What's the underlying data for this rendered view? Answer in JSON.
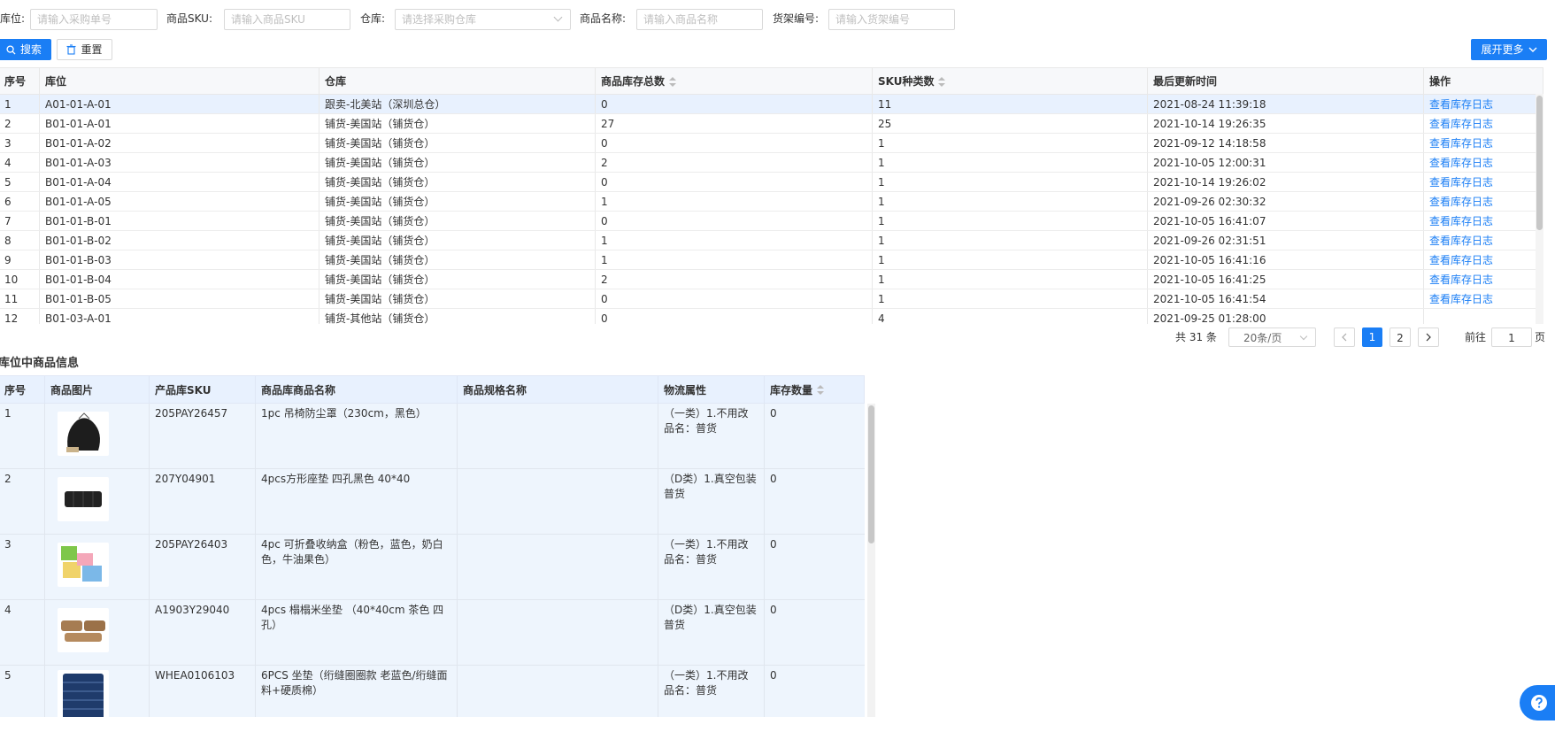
{
  "filters": {
    "location": {
      "label": "库位:",
      "placeholder": "请输入采购单号"
    },
    "sku": {
      "label": "商品SKU:",
      "placeholder": "请输入商品SKU"
    },
    "warehouse": {
      "label": "仓库:",
      "placeholder": "请选择采购仓库"
    },
    "name": {
      "label": "商品名称:",
      "placeholder": "请输入商品名称"
    },
    "shelf": {
      "label": "货架编号:",
      "placeholder": "请输入货架编号"
    }
  },
  "buttons": {
    "search": "搜索",
    "reset": "重置",
    "expand": "展开更多"
  },
  "colors": {
    "primary": "#1a7ef5",
    "selected_row": "#e8f1fe"
  },
  "main_table": {
    "columns": [
      "序号",
      "库位",
      "仓库",
      "商品库存总数",
      "SKU种类数",
      "最后更新时间",
      "操作"
    ],
    "rows": [
      {
        "no": "1",
        "loc": "A01-01-A-01",
        "wh": "跟卖-北美站（深圳总仓）",
        "total": "0",
        "kinds": "11",
        "time": "2021-08-24 11:39:18",
        "action": "查看库存日志"
      },
      {
        "no": "2",
        "loc": "B01-01-A-01",
        "wh": "铺货-美国站（铺货仓）",
        "total": "27",
        "kinds": "25",
        "time": "2021-10-14 19:26:35",
        "action": "查看库存日志"
      },
      {
        "no": "3",
        "loc": "B01-01-A-02",
        "wh": "铺货-美国站（铺货仓）",
        "total": "0",
        "kinds": "1",
        "time": "2021-09-12 14:18:58",
        "action": "查看库存日志"
      },
      {
        "no": "4",
        "loc": "B01-01-A-03",
        "wh": "铺货-美国站（铺货仓）",
        "total": "2",
        "kinds": "1",
        "time": "2021-10-05 12:00:31",
        "action": "查看库存日志"
      },
      {
        "no": "5",
        "loc": "B01-01-A-04",
        "wh": "铺货-美国站（铺货仓）",
        "total": "0",
        "kinds": "1",
        "time": "2021-10-14 19:26:02",
        "action": "查看库存日志"
      },
      {
        "no": "6",
        "loc": "B01-01-A-05",
        "wh": "铺货-美国站（铺货仓）",
        "total": "1",
        "kinds": "1",
        "time": "2021-09-26 02:30:32",
        "action": "查看库存日志"
      },
      {
        "no": "7",
        "loc": "B01-01-B-01",
        "wh": "铺货-美国站（铺货仓）",
        "total": "0",
        "kinds": "1",
        "time": "2021-10-05 16:41:07",
        "action": "查看库存日志"
      },
      {
        "no": "8",
        "loc": "B01-01-B-02",
        "wh": "铺货-美国站（铺货仓）",
        "total": "1",
        "kinds": "1",
        "time": "2021-09-26 02:31:51",
        "action": "查看库存日志"
      },
      {
        "no": "9",
        "loc": "B01-01-B-03",
        "wh": "铺货-美国站（铺货仓）",
        "total": "1",
        "kinds": "1",
        "time": "2021-10-05 16:41:16",
        "action": "查看库存日志"
      },
      {
        "no": "10",
        "loc": "B01-01-B-04",
        "wh": "铺货-美国站（铺货仓）",
        "total": "2",
        "kinds": "1",
        "time": "2021-10-05 16:41:25",
        "action": "查看库存日志"
      },
      {
        "no": "11",
        "loc": "B01-01-B-05",
        "wh": "铺货-美国站（铺货仓）",
        "total": "0",
        "kinds": "1",
        "time": "2021-10-05 16:41:54",
        "action": "查看库存日志"
      },
      {
        "no": "12",
        "loc": "B01-03-A-01",
        "wh": "铺货-其他站（铺货仓）",
        "total": "0",
        "kinds": "4",
        "time": "2021-09-25 01:28:00",
        "action": ""
      }
    ]
  },
  "pagination": {
    "total": "共 31 条",
    "page_size": "20条/页",
    "pages": [
      "1",
      "2"
    ],
    "current": "1",
    "goto_label": "前往",
    "goto_value": "1",
    "goto_suffix": "页"
  },
  "detail": {
    "title": "库位中商品信息",
    "columns": [
      "序号",
      "商品图片",
      "产品库SKU",
      "商品库商品名称",
      "商品规格名称",
      "物流属性",
      "库存数量"
    ],
    "rows": [
      {
        "no": "1",
        "image": "black-hammock-cover",
        "sku": "205PAY26457",
        "name": "1pc 吊椅防尘罩（230cm，黑色）",
        "spec": "",
        "logistics": "（一类）1.不用改品名：普货",
        "qty": "0"
      },
      {
        "no": "2",
        "image": "black-square-cushion",
        "sku": "207Y04901",
        "name": "4pcs方形座垫 四孔黑色 40*40",
        "spec": "",
        "logistics": "（D类）1.真空包装普货",
        "qty": "0"
      },
      {
        "no": "3",
        "image": "foldable-storage-boxes",
        "sku": "205PAY26403",
        "name": "4pc 可折叠收纳盒（粉色，蓝色，奶白色，牛油果色）",
        "spec": "",
        "logistics": "（一类）1.不用改品名：普货",
        "qty": "0"
      },
      {
        "no": "4",
        "image": "tan-tatami-cushions",
        "sku": "A1903Y29040",
        "name": "4pcs 榻榻米坐垫 （40*40cm 茶色 四孔）",
        "spec": "",
        "logistics": "（D类）1.真空包装普货",
        "qty": "0"
      },
      {
        "no": "5",
        "image": "navy-seat-cushions",
        "sku": "WHEA0106103",
        "name": "6PCS 坐垫（绗缝圈圈款 老蓝色/绗缝面料+硬质棉）",
        "spec": "",
        "logistics": "（一类）1.不用改品名：普货",
        "qty": "0"
      }
    ]
  },
  "help_icon": "question-icon"
}
